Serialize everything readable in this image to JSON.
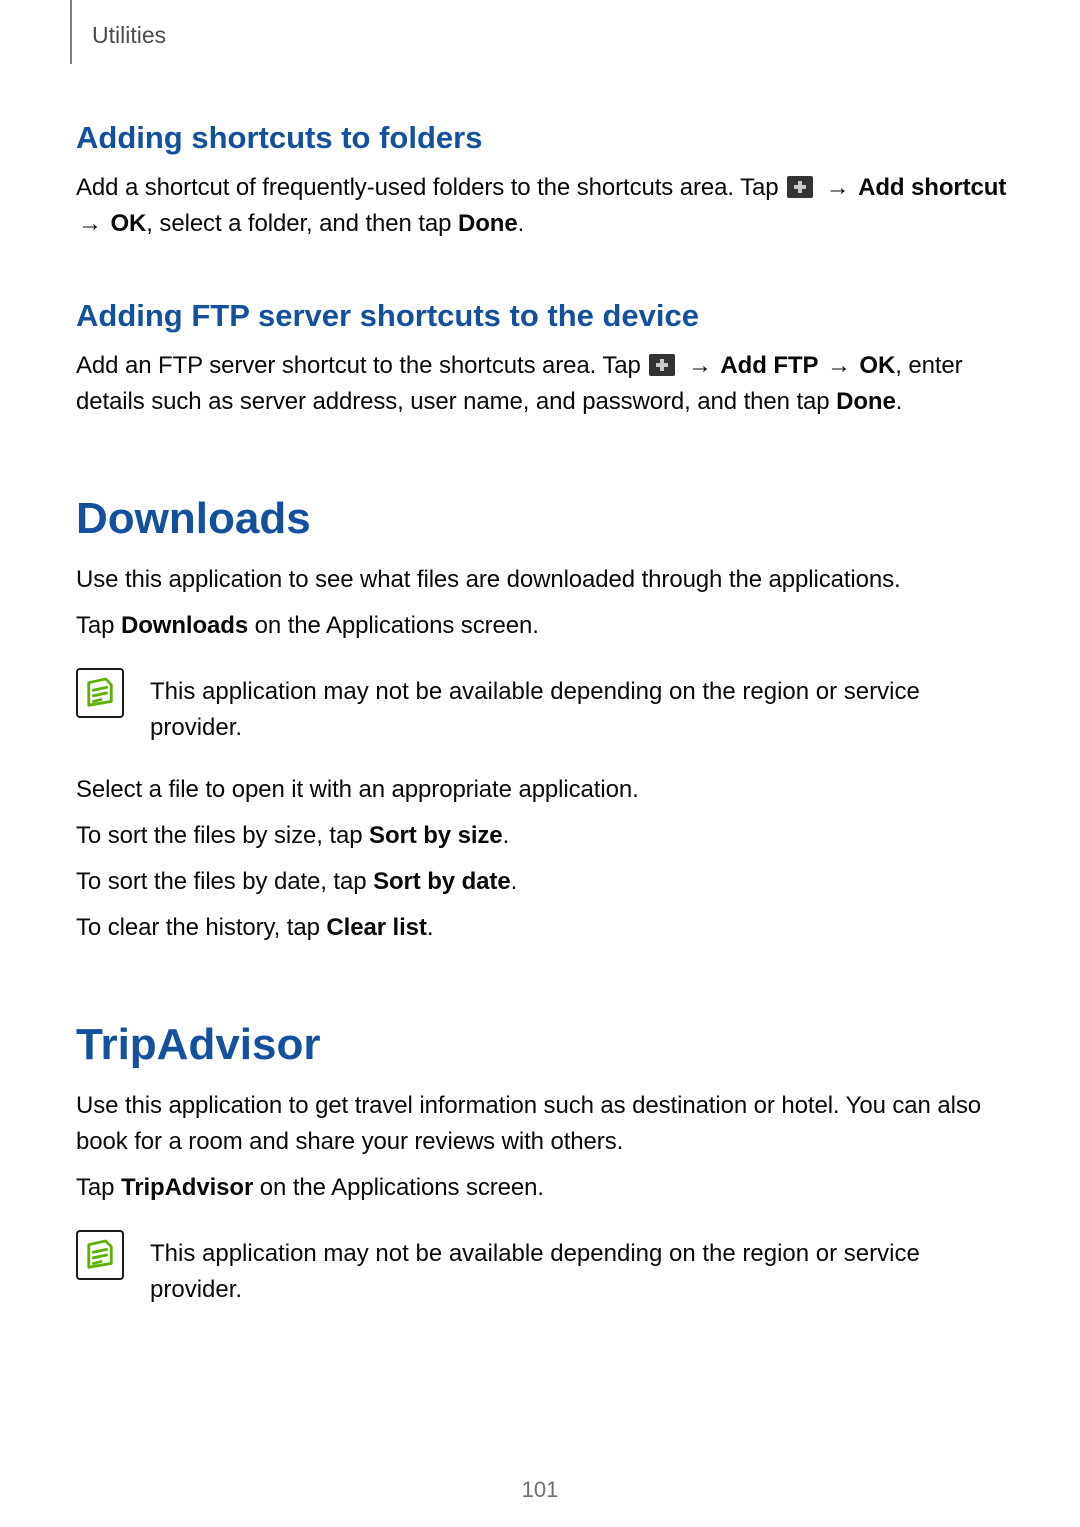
{
  "header": {
    "section": "Utilities"
  },
  "s1": {
    "heading": "Adding shortcuts to folders",
    "p1_a": "Add a shortcut of frequently-used folders to the shortcuts area. Tap ",
    "arrow1": "→",
    "bold_add_shortcut": "Add shortcut",
    "arrow2": "→",
    "bold_ok": "OK",
    "p1_b": ", select a folder, and then tap ",
    "bold_done": "Done",
    "period": "."
  },
  "s2": {
    "heading": "Adding FTP server shortcuts to the device",
    "p1_a": "Add an FTP server shortcut to the shortcuts area. Tap ",
    "arrow1": "→",
    "bold_add_ftp": "Add FTP",
    "arrow2": "→",
    "bold_ok": "OK",
    "p1_b": ", enter details such as server address, user name, and password, and then tap ",
    "bold_done": "Done",
    "period": "."
  },
  "downloads": {
    "heading": "Downloads",
    "p1": "Use this application to see what files are downloaded through the applications.",
    "p2_a": "Tap ",
    "p2_bold": "Downloads",
    "p2_b": " on the Applications screen.",
    "note": "This application may not be available depending on the region or service provider.",
    "p3": "Select a file to open it with an appropriate application.",
    "p4_a": "To sort the files by size, tap ",
    "p4_bold": "Sort by size",
    "p4_b": ".",
    "p5_a": "To sort the files by date, tap ",
    "p5_bold": "Sort by date",
    "p5_b": ".",
    "p6_a": "To clear the history, tap ",
    "p6_bold": "Clear list",
    "p6_b": "."
  },
  "tripadvisor": {
    "heading": "TripAdvisor",
    "p1": "Use this application to get travel information such as destination or hotel. You can also book for a room and share your reviews with others.",
    "p2_a": "Tap ",
    "p2_bold": "TripAdvisor",
    "p2_b": " on the Applications screen.",
    "note": "This application may not be available depending on the region or service provider."
  },
  "page_number": "101"
}
